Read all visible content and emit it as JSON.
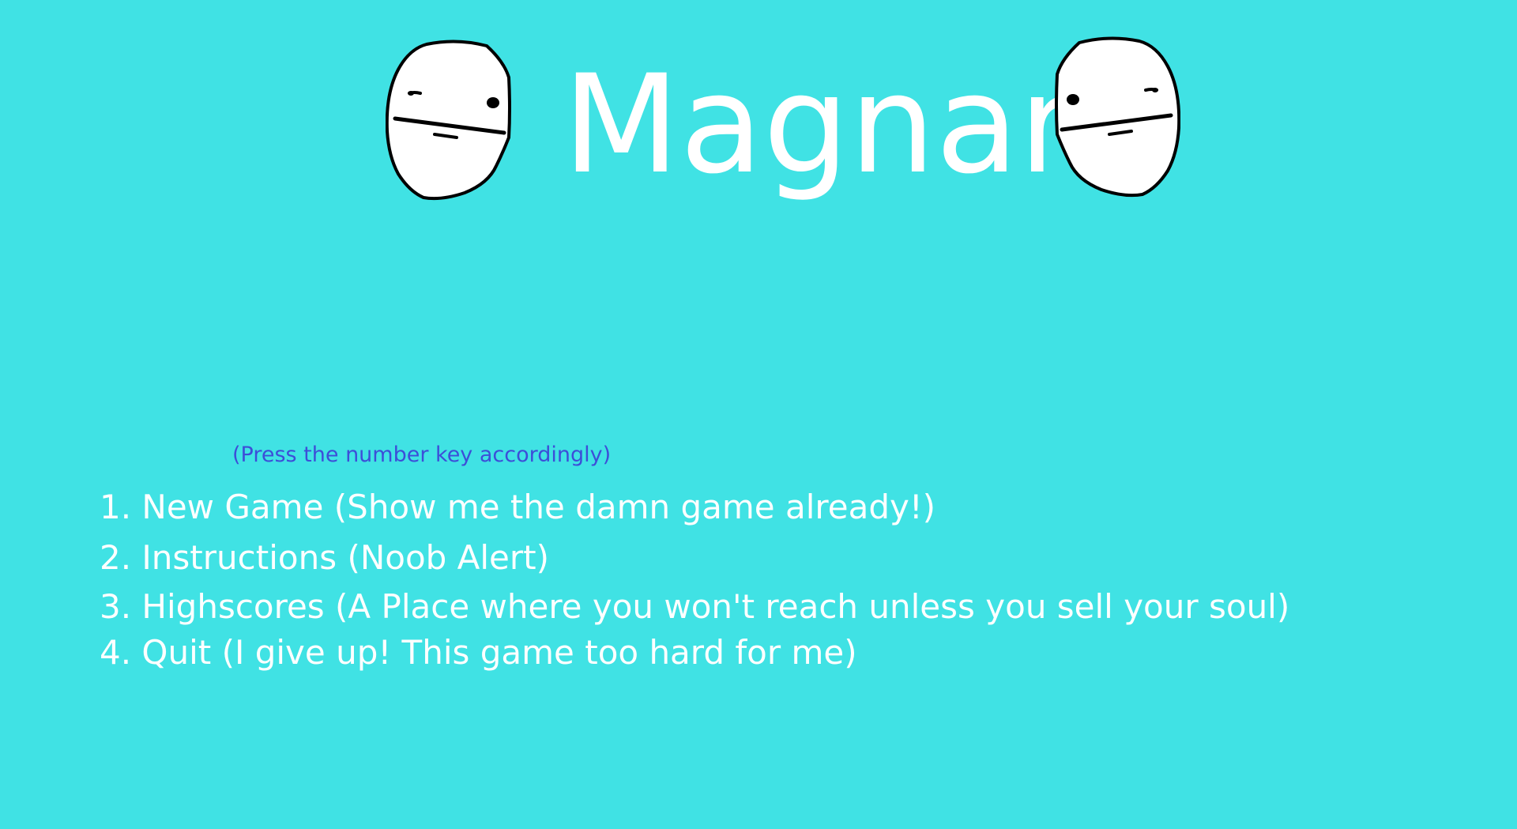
{
  "game": {
    "title": "Magnar",
    "hint": "(Press the number key accordingly)",
    "background_color": "#40e2e4",
    "title_color": "#ffffff",
    "hint_color": "#3d4ed8",
    "decoration_icon": "poker-face-icon",
    "menu": [
      {
        "key": "1",
        "label": "1. New Game (Show me the damn game already!)"
      },
      {
        "key": "2",
        "label": "2. Instructions (Noob Alert)"
      },
      {
        "key": "3",
        "label": "3. Highscores (A Place where you won't reach unless you sell your soul)"
      },
      {
        "key": "4",
        "label": "4. Quit (I give up! This game too hard for me)"
      }
    ]
  }
}
